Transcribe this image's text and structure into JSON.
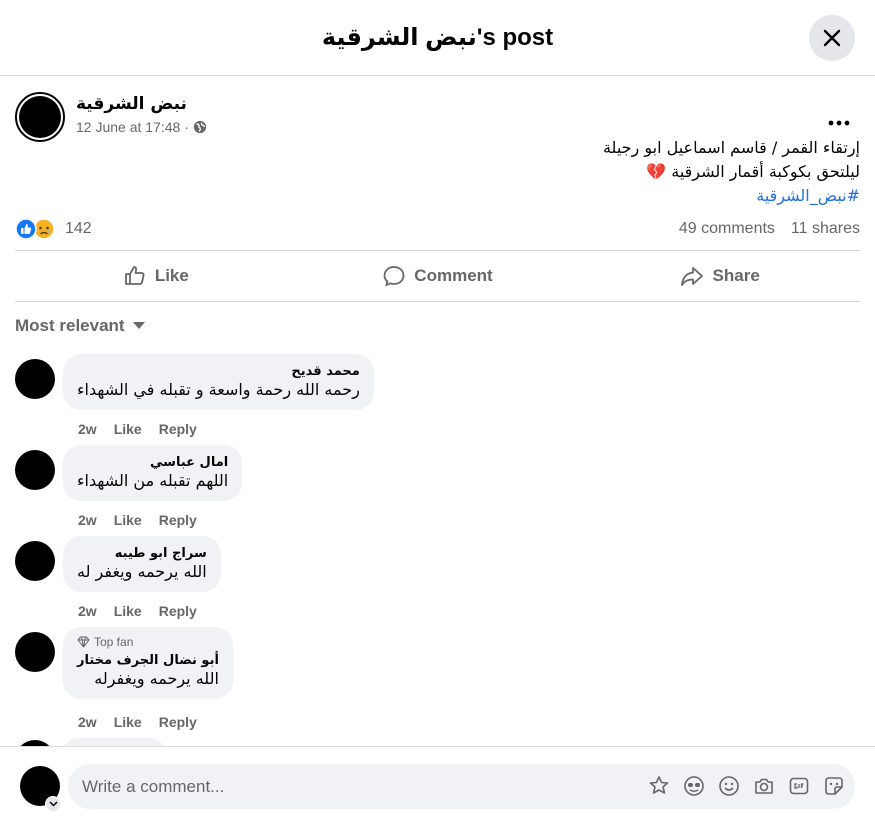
{
  "dialog": {
    "title": "نبض الشرقية's post"
  },
  "post": {
    "author": "نبض الشرقية",
    "timestamp": "12 June at 17:48",
    "audience_icon": "globe-icon",
    "lines": [
      "إرتقاء القمر / قاسم اسماعيل ابو رجيلة",
      "ليلتحق بكوكبة أقمار الشرقية 💔"
    ],
    "hashtag": "#نبض_الشرقية",
    "reaction_count": "142",
    "reaction_icons": [
      "like-icon",
      "sad-icon"
    ],
    "comments_count": "49 comments",
    "shares_count": "11 shares"
  },
  "actions": {
    "like": "Like",
    "comment": "Comment",
    "share": "Share"
  },
  "sort": {
    "label": "Most relevant"
  },
  "comments": [
    {
      "name": "محمد قديح",
      "text": "رحمه الله رحمة واسعة و تقبله في الشهداء",
      "time": "2w",
      "like": "Like",
      "reply": "Reply"
    },
    {
      "name": "امال عباسي",
      "text": "اللهم تقبله من الشهداء",
      "time": "2w",
      "like": "Like",
      "reply": "Reply"
    },
    {
      "name": "سراج ابو طيبه",
      "text": "الله يرحمه ويغفر له",
      "time": "2w",
      "like": "Like",
      "reply": "Reply"
    },
    {
      "badge": "Top fan",
      "name": "أبو نضال الجرف مختار",
      "text": "الله يرحمه ويغفرله",
      "time": "2w",
      "like": "Like",
      "reply": "Reply"
    }
  ],
  "composer": {
    "placeholder": "Write a comment...",
    "icons": [
      "avatar-sticker-icon",
      "emoji-face-icon",
      "smiley-icon",
      "camera-icon",
      "gif-icon",
      "sticker-icon"
    ]
  },
  "colors": {
    "accent": "#216fdb",
    "secondary_text": "#65676b",
    "bubble_bg": "#f0f2f5"
  }
}
